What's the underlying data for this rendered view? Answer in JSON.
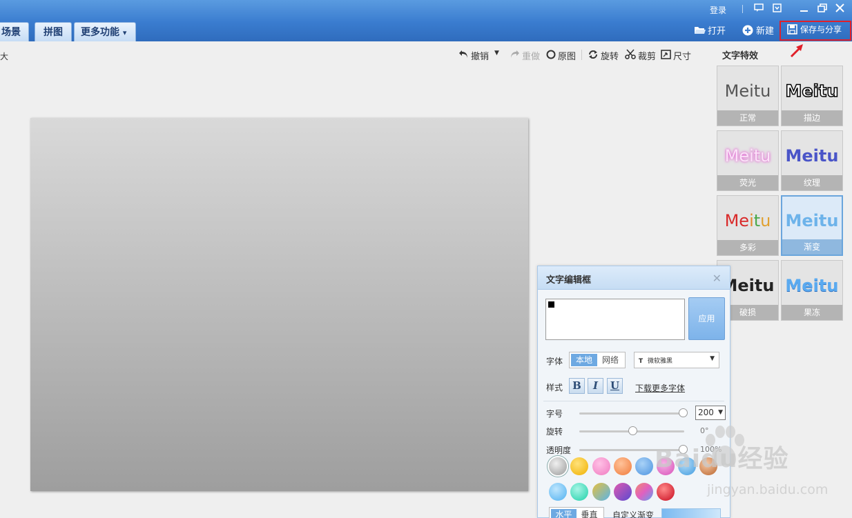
{
  "titlebar": {
    "login": "登录",
    "tabs": [
      "场景",
      "拼图",
      "更多功能"
    ],
    "more_arrow": "▾",
    "actions": {
      "open": "打开",
      "new": "新建",
      "save_share": "保存与分享"
    },
    "window_icons": [
      "message-icon",
      "skin-icon",
      "minimize-icon",
      "restore-icon",
      "close-icon"
    ]
  },
  "toolbar": {
    "zoom_label": "原大",
    "undo": "撤销",
    "redo": "重做",
    "original": "原图",
    "rotate": "旋转",
    "crop": "裁剪",
    "size": "尺寸"
  },
  "effects": {
    "title": "文字特效",
    "sample_text": "Meitu",
    "items": [
      {
        "label": "正常",
        "color": "#555555"
      },
      {
        "label": "描边",
        "color": "#000000"
      },
      {
        "label": "荧光",
        "color": "#f6b8f0"
      },
      {
        "label": "纹理",
        "color": "#4a55c8"
      },
      {
        "label": "多彩",
        "color": "#d92a2a"
      },
      {
        "label": "渐变",
        "color": "#5aa8e6"
      },
      {
        "label": "破损",
        "color": "#222222"
      },
      {
        "label": "果冻",
        "color": "#4f9fe8"
      }
    ],
    "selected": "渐变"
  },
  "dialog": {
    "title": "文字编辑框",
    "apply": "应用",
    "font_label": "字体",
    "font_source": [
      "本地",
      "网络"
    ],
    "font_name": "微软雅黑",
    "style_label": "样式",
    "style_buttons": [
      "B",
      "I",
      "U"
    ],
    "more_fonts": "下载更多字体",
    "size_label": "字号",
    "size_value": "200",
    "rotate_label": "旋转",
    "rotate_value": "0°",
    "opacity_label": "透明度",
    "opacity_value": "100%",
    "size_slider_fraction": 1.0,
    "rotate_slider_fraction": 0.5,
    "opacity_slider_fraction": 1.0,
    "swatches_row1": [
      "#c8c8c8",
      "#f7c31f",
      "#f58ac7",
      "#f58a4a",
      "#6aa9ea",
      "#e873c9",
      "#5fb3ea",
      "#e9935a"
    ],
    "swatches_row2": [
      "#6cc6f5",
      "#3fe0c0",
      "#a8c060",
      "#9b5ac8",
      "#ee8090",
      "#dd2a2a"
    ],
    "direction": [
      "水平",
      "垂直"
    ],
    "custom_gradient": "自定义渐变"
  },
  "watermark": {
    "brand": "Baidu经验",
    "url": "jingyan.baidu.com"
  }
}
